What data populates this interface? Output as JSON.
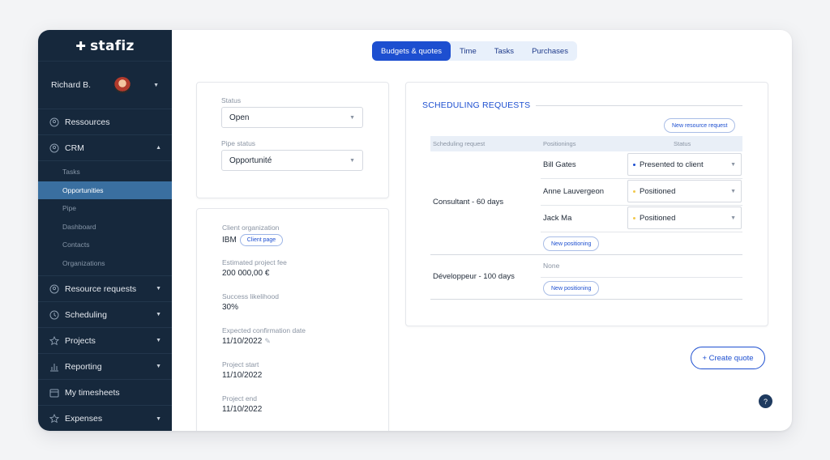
{
  "brand": {
    "logo_text": "stafiz"
  },
  "user": {
    "name": "Richard B."
  },
  "sidebar": {
    "items": [
      {
        "label": "Ressources",
        "icon": "user-circle-icon"
      },
      {
        "label": "CRM",
        "icon": "user-circle-icon"
      },
      {
        "label": "Resource requests",
        "icon": "user-circle-icon"
      },
      {
        "label": "Scheduling",
        "icon": "clock-icon"
      },
      {
        "label": "Projects",
        "icon": "star-icon"
      },
      {
        "label": "Reporting",
        "icon": "bar-chart-icon"
      },
      {
        "label": "My timesheets",
        "icon": "calendar-icon"
      },
      {
        "label": "Expenses",
        "icon": "star-icon"
      }
    ],
    "crm_sub": [
      "Tasks",
      "Opportunities",
      "Pipe",
      "Dashboard",
      "Contacts",
      "Organizations"
    ],
    "active_sub": "Opportunities"
  },
  "tabs": [
    "Budgets & quotes",
    "Time",
    "Tasks",
    "Purchases"
  ],
  "status_card": {
    "status_label": "Status",
    "status_value": "Open",
    "pipe_label": "Pipe status",
    "pipe_value": "Opportunité"
  },
  "details": {
    "client_org_label": "Client organization",
    "client_org_value": "IBM",
    "client_page": "Client page",
    "fee_label": "Estimated project fee",
    "fee_value": "200 000,00 €",
    "likelihood_label": "Success likelihood",
    "likelihood_value": "30%",
    "confirm_label": "Expected confirmation date",
    "confirm_value": "11/10/2022",
    "start_label": "Project start",
    "start_value": "11/10/2022",
    "end_label": "Project end",
    "end_value": "11/10/2022"
  },
  "scheduling": {
    "title": "SCHEDULING REQUESTS",
    "new_request": "New resource request",
    "headers": [
      "Scheduling request",
      "Positionings",
      "Status"
    ],
    "requests": [
      {
        "name": "Consultant - 60 days",
        "positionings": [
          {
            "person": "Bill Gates",
            "status": "Presented to client",
            "dot": "#1d4fd0"
          },
          {
            "person": "Anne Lauvergeon",
            "status": "Positioned",
            "dot": "#f2c94c"
          },
          {
            "person": "Jack Ma",
            "status": "Positioned",
            "dot": "#f2c94c"
          }
        ],
        "new_positioning": "New positioning"
      },
      {
        "name": "Développeur - 100 days",
        "positionings_empty": "None",
        "new_positioning": "New positioning"
      }
    ]
  },
  "actions": {
    "create_quote": "+ Create quote",
    "help": "?"
  }
}
